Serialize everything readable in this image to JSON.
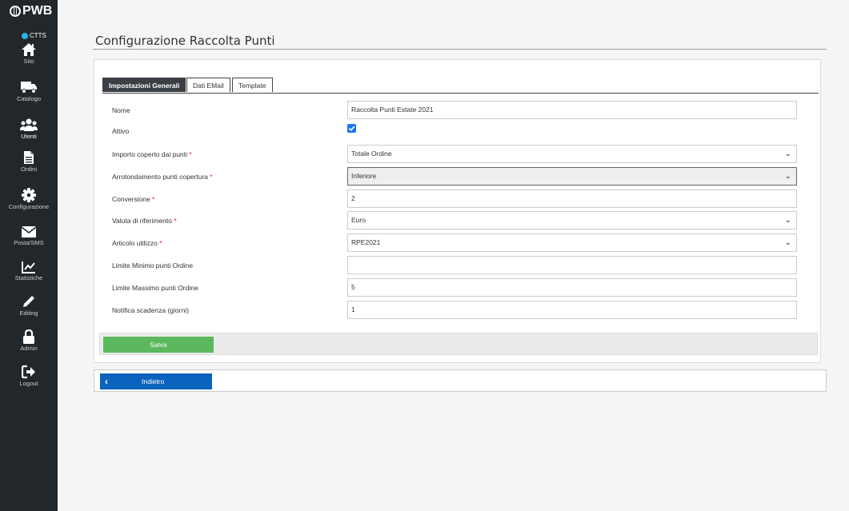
{
  "app": {
    "logo": "PWB",
    "org": "CTTS"
  },
  "colors": {
    "sidebar": "#22272c",
    "accent_dot": "#28b5e8",
    "save": "#5cb85c",
    "back": "#0a63bd",
    "tab_active": "#3a3f45",
    "required": "#e02020",
    "checkbox": "#1877f2"
  },
  "sidebar": {
    "items": [
      {
        "label": "Sito",
        "icon": "home-icon"
      },
      {
        "label": "Catalogo",
        "icon": "truck-icon"
      },
      {
        "label": "Utenti",
        "icon": "users-icon",
        "active": true
      },
      {
        "label": "Ordini",
        "icon": "file-icon"
      },
      {
        "label": "Configurazione",
        "icon": "gear-icon"
      },
      {
        "label": "Posta/SMS",
        "icon": "envelope-icon"
      },
      {
        "label": "Statistiche",
        "icon": "chart-icon"
      },
      {
        "label": "Editing",
        "icon": "pencil-icon"
      },
      {
        "label": "Admin",
        "icon": "lock-icon"
      },
      {
        "label": "Logout",
        "icon": "logout-icon"
      }
    ]
  },
  "page": {
    "title": "Configurazione Raccolta Punti"
  },
  "tabs": [
    {
      "label": "Impostazioni Generali",
      "active": true
    },
    {
      "label": "Dati EMail",
      "active": false
    },
    {
      "label": "Template",
      "active": false
    }
  ],
  "form": {
    "fields": [
      {
        "label": "Nome",
        "required": false,
        "type": "text",
        "value": "Raccolta Punti Estate 2021"
      },
      {
        "label": "Attivo",
        "required": false,
        "type": "checkbox",
        "checked": true
      },
      {
        "label": "Importo coperto dai punti",
        "required": true,
        "type": "select",
        "value": "Totale Ordine"
      },
      {
        "label": "Arrotondamento punti copertura",
        "required": true,
        "type": "select",
        "value": "Inferiore",
        "focused": true
      },
      {
        "label": "Conversione",
        "required": true,
        "type": "text",
        "value": "2"
      },
      {
        "label": "Valuta di riferimento",
        "required": true,
        "type": "select",
        "value": "Euro"
      },
      {
        "label": "Articolo utilizzo",
        "required": true,
        "type": "select",
        "value": "RPE2021"
      },
      {
        "label": "Limite Minimo punti Ordine",
        "required": false,
        "type": "text",
        "value": ""
      },
      {
        "label": "Limite Massimo punti Ordine",
        "required": false,
        "type": "text",
        "value": "5"
      },
      {
        "label": "Notifica scadenza (giorni)",
        "required": false,
        "type": "text",
        "value": "1"
      }
    ],
    "required_marker": "*",
    "save_label": "Salva"
  },
  "back": {
    "label": "Indietro"
  }
}
